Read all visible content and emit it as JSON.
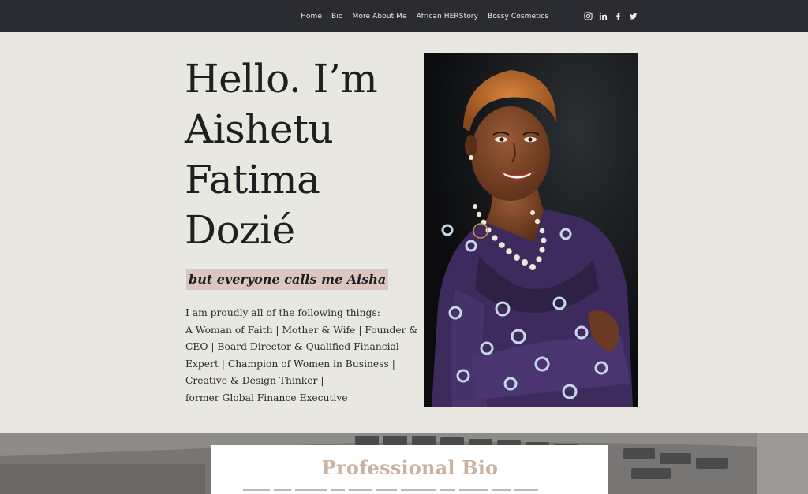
{
  "nav": {
    "items": [
      {
        "label": "Home"
      },
      {
        "label": "Bio"
      },
      {
        "label": "More About Me"
      },
      {
        "label": "African HERStory"
      },
      {
        "label": "Bossy Cosmetics"
      }
    ],
    "social": [
      "instagram-icon",
      "linkedin-icon",
      "facebook-icon",
      "twitter-icon"
    ]
  },
  "hero": {
    "title_lines": [
      "Hello. I’m",
      "Aishetu",
      "Fatima",
      "Dozié"
    ],
    "tagline": "but everyone calls me Aisha",
    "description_lines": [
      "I am proudly all of the following things:",
      "A Woman of Faith | Mother & Wife | Founder &",
      "CEO | Board Director & Qualified Financial",
      "Expert | Champion of Women in Business |",
      "Creative & Design Thinker |",
      "former Global Finance Executive"
    ]
  },
  "bio": {
    "title": "Professional Bio"
  },
  "colors": {
    "header_bg": "#2b2c31",
    "page_bg": "#e8e7e0",
    "tagline_highlight": "#d9c7c0",
    "bio_title": "#c9b29f"
  }
}
